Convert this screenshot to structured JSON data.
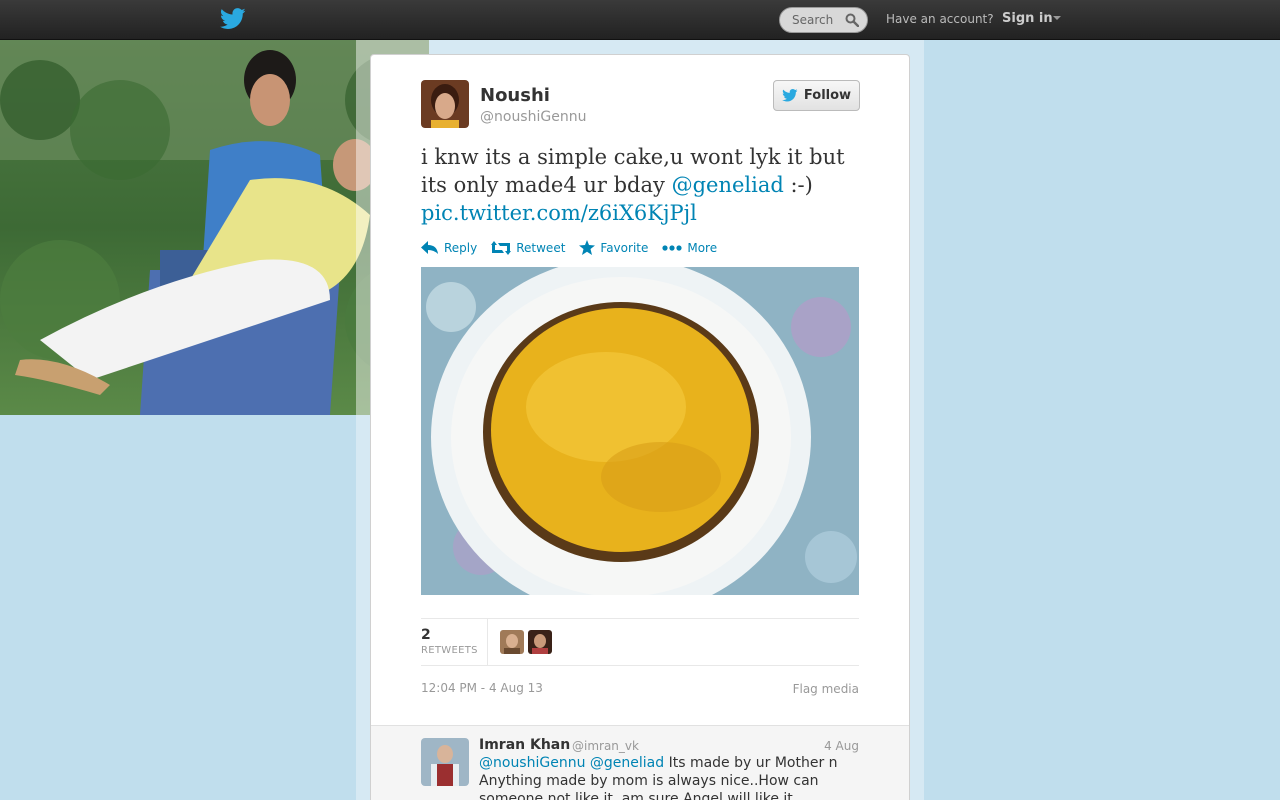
{
  "topbar": {
    "logo_icon": "twitter-bird-icon",
    "search_placeholder": "Search",
    "search_icon": "magnifier-icon",
    "have_account": "Have an account?",
    "sign_in": "Sign in"
  },
  "tweet": {
    "fullname": "Noushi",
    "screen_name": "@noushiGennu",
    "follow_label": "Follow",
    "text_plain": "i knw its a simple cake,u wont lyk it but its only made4 ur bday",
    "mention": "@geneliad",
    "smiley": ":-)",
    "pic_link": "pic.twitter.com/z6iX6KjPjl",
    "actions": {
      "reply": "Reply",
      "retweet": "Retweet",
      "favorite": "Favorite",
      "more": "More"
    },
    "retweet_count": "2",
    "retweets_label": "RETWEETS",
    "timestamp": "12:04 PM - 4 Aug 13",
    "flag_media": "Flag media"
  },
  "reply": {
    "name": "Imran Khan",
    "handle": "@imran_vk",
    "date": "4 Aug",
    "mention1": "@noushiGennu",
    "mention2": "@geneliad",
    "text": "Its made by ur Mother n Anything made by mom is always nice..How can someone not like it..am sure Angel will like it"
  },
  "colors": {
    "background": "#c0deed",
    "link": "#0084b4",
    "topbar": "#2b2b2b",
    "twitter_blue": "#2aa9e0"
  }
}
